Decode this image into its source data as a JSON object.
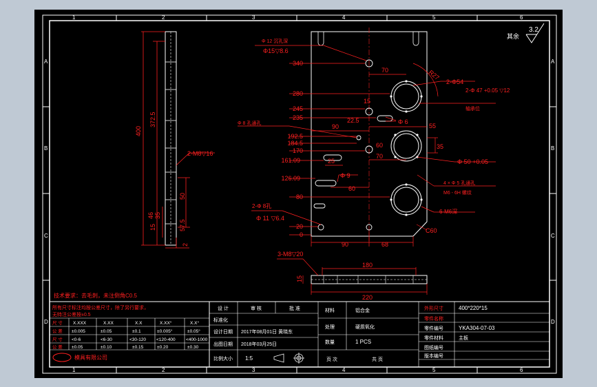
{
  "colors": {
    "background_outer": "#bfc9d4",
    "sheet": "#000000",
    "frame": "#ffffff",
    "part": "#ffffff",
    "dimension": "#ff2020",
    "annotation": "#ff2020"
  },
  "border": {
    "col_labels": [
      "1",
      "2",
      "3",
      "4",
      "5",
      "6"
    ],
    "row_labels": [
      "A",
      "B",
      "C",
      "D"
    ]
  },
  "roughness": {
    "value": "3.2",
    "label": "其余"
  },
  "side_view": {
    "dims": {
      "overall": "400",
      "inner": "372.5",
      "slot_depth": "50",
      "spacing_a": "57.5",
      "spacing_b": "15",
      "spacing_c": "4",
      "thickness": "2",
      "small_a": "46",
      "small_b": "35"
    },
    "callout": "2-M8▽16"
  },
  "front_view": {
    "callouts": {
      "top_hole": "Φ 12 沉孔深",
      "top_hole_size": "Φ15▽8.6",
      "bore_54": "2-Φ54",
      "bore_47": "2-Φ 47 +0.05 ▽12",
      "bore_47_note": "轴承位",
      "left_hole": "Φ 8 孔通孔",
      "hole_6": "Φ 6",
      "bore_50": "Φ 50 +0.05",
      "hole_9": "Φ 9",
      "four_holes": "4 × Φ 5 孔通孔",
      "four_holes_note": "M6 - 6H 螺纹",
      "m6": "6-M6深",
      "left_bottom": "2-Φ 8孔",
      "left_bottom_size": "Φ 11 ▽6.4",
      "chamfer": "C60",
      "radius": "R27"
    },
    "ydims": [
      "340",
      "280",
      "245",
      "235",
      "192.5",
      "184.5",
      "170",
      "161.09",
      "126.09",
      "80",
      "20",
      "0"
    ],
    "xdims": {
      "d70a": "70",
      "d15": "15",
      "d22_5": "22.5",
      "d90": "90",
      "d60a": "60",
      "d70b": "70",
      "d55": "55",
      "d35": "35",
      "d25": "25",
      "d60b": "60",
      "d90b": "90",
      "d68": "68"
    }
  },
  "bottom_view": {
    "callout": "3-M8▽20",
    "dims": {
      "width": "220",
      "inner": "180",
      "thickness": "15"
    }
  },
  "notes": {
    "tech_req": "技术要求：去毛刺，未注倒角C0.5"
  },
  "tolerance_table": {
    "title_lines": [
      "所有尺寸标注均按公差尺寸，除了另行要求，",
      "无特注公差按±0.5"
    ],
    "header": [
      "尺 寸",
      "X.XXX",
      "X.XX",
      "X.X",
      "X.XX°",
      "X.X°"
    ],
    "rows": [
      [
        "公 差",
        "±0.005",
        "±0.05",
        "±0.1",
        "±0.005°",
        "±0.05°"
      ],
      [
        "尺 寸",
        "<0-6",
        "<6-30",
        "<30-120",
        "<120-400",
        "<400-1000"
      ],
      [
        "公 差",
        "±0.05",
        "±0.10",
        "±0.15",
        "±0.20",
        "±0.30"
      ]
    ],
    "company": "模具有限公司"
  },
  "title_block": {
    "sign_row": [
      "设 计",
      "审 核",
      "批 准"
    ],
    "rows": [
      {
        "label": "标准化",
        "value": ""
      },
      {
        "label": "设计日期",
        "value": "2017年08月01日  黄晓东"
      },
      {
        "label": "出图日期",
        "value": "2018年03月25日"
      },
      {
        "label": "比例大小",
        "value": "1:5"
      }
    ],
    "mid": [
      {
        "label": "材料",
        "value": "铝合金"
      },
      {
        "label": "处理",
        "value": "硬质氧化"
      },
      {
        "label": "数量",
        "value": "1 PCS"
      }
    ],
    "mid_footer": [
      "页 次",
      "共 页"
    ],
    "right": [
      {
        "label": "外形尺寸",
        "value": "400*220*15"
      },
      {
        "label": "零件名称",
        "value": ""
      },
      {
        "label": "零件编号",
        "value": "YKA304-07-03"
      },
      {
        "label": "零件材料",
        "value": "主板"
      },
      {
        "label": "图纸编号",
        "value": ""
      },
      {
        "label": "版本编号",
        "value": ""
      }
    ]
  }
}
